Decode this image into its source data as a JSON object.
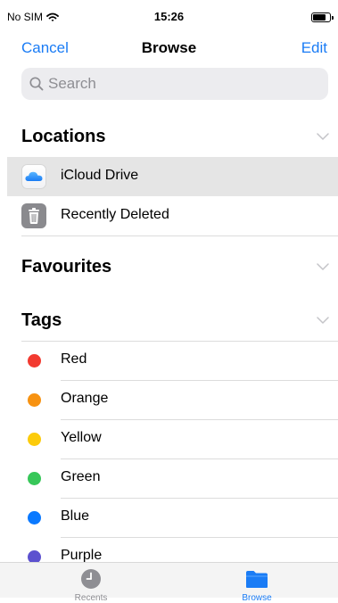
{
  "status_bar": {
    "carrier": "No SIM",
    "time": "15:26",
    "battery_level": 0.75
  },
  "nav": {
    "cancel": "Cancel",
    "title": "Browse",
    "edit": "Edit"
  },
  "search": {
    "placeholder": "Search"
  },
  "sections": {
    "locations": "Locations",
    "favourites": "Favourites",
    "tags": "Tags"
  },
  "locations": [
    {
      "label": "iCloud Drive",
      "icon": "icloud-drive-icon",
      "selected": true
    },
    {
      "label": "Recently Deleted",
      "icon": "trash-icon",
      "selected": false
    }
  ],
  "tags": [
    {
      "label": "Red",
      "color": "#f23a30"
    },
    {
      "label": "Orange",
      "color": "#f79211"
    },
    {
      "label": "Yellow",
      "color": "#fccb0b"
    },
    {
      "label": "Green",
      "color": "#37c759"
    },
    {
      "label": "Blue",
      "color": "#0a79ff"
    },
    {
      "label": "Purple",
      "color": "#5c51cf"
    }
  ],
  "tab_bar": {
    "tabs": [
      {
        "label": "Recents",
        "icon": "clock-icon",
        "active": false,
        "color": "#8e8e93"
      },
      {
        "label": "Browse",
        "icon": "folder-icon",
        "active": true,
        "color": "#1a7cf5"
      }
    ]
  }
}
